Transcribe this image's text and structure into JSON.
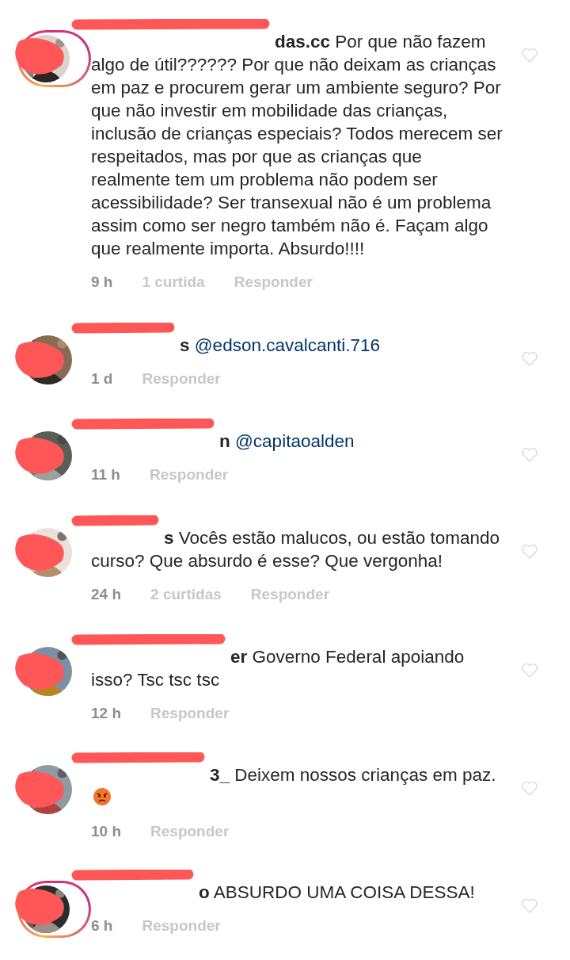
{
  "comments": [
    {
      "username": "das.cc",
      "story_ring": true,
      "body": "Por que não fazem algo de útil?????? Por que não deixam as crianças em paz e procurem gerar um ambiente seguro? Por que não investir em mobilidade das crianças, inclusão de crianças especiais? Todos merecem ser respeitados, mas por que as crianças que realmente tem um problema não podem ser acessibilidade? Ser transexual não é um problema assim como ser negro também não é. Façam algo que realmente importa. Absurdo!!!!",
      "time": "9 h",
      "likes": "1 curtida",
      "reply": "Responder"
    },
    {
      "username": "s",
      "story_ring": false,
      "mention": "@edson.cavalcanti.716",
      "time": "1 d",
      "reply": "Responder"
    },
    {
      "username": "n",
      "story_ring": false,
      "mention": "@capitaoalden",
      "time": "11 h",
      "reply": "Responder"
    },
    {
      "username": "s",
      "story_ring": false,
      "body": "Vocês estão malucos, ou estão tomando curso? Que absurdo é esse? Que vergonha!",
      "time": "24 h",
      "likes": "2 curtidas",
      "reply": "Responder"
    },
    {
      "username": "er",
      "story_ring": false,
      "body": "Governo Federal apoiando isso? Tsc tsc tsc",
      "time": "12 h",
      "reply": "Responder"
    },
    {
      "username": "3_",
      "story_ring": false,
      "body": "Deixem nossos crianças em paz.",
      "emoji": true,
      "time": "10 h",
      "reply": "Responder"
    },
    {
      "username": "o",
      "story_ring": true,
      "body": "ABSURDO UMA COISA DESSA!",
      "time": "6 h",
      "reply": "Responder"
    }
  ]
}
